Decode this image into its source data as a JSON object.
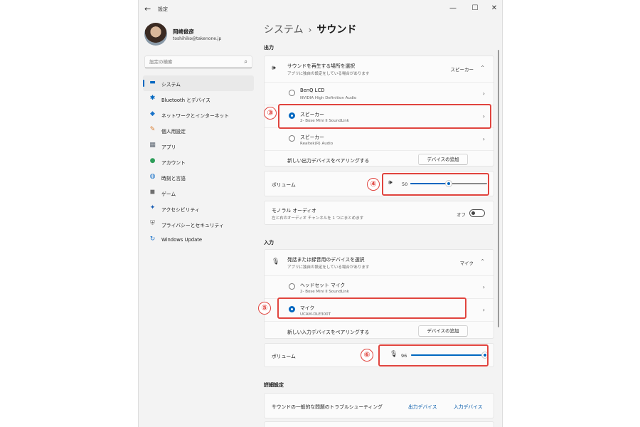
{
  "window": {
    "app_title": "設定",
    "back_icon": "←",
    "minimize_icon": "—",
    "maximize_icon": "☐",
    "close_icon": "✕"
  },
  "profile": {
    "name": "岡崎俊彦",
    "email": "toshihiko@takenone.jp"
  },
  "search": {
    "placeholder": "設定の検索",
    "icon": "⌕"
  },
  "sidebar": {
    "items": [
      {
        "label": "システム",
        "icon": "▬",
        "icon_color": "#0067c0",
        "active": true
      },
      {
        "label": "Bluetooth とデバイス",
        "icon": "✱",
        "icon_color": "#0067c0"
      },
      {
        "label": "ネットワークとインターネット",
        "icon": "◆",
        "icon_color": "#1a73c9"
      },
      {
        "label": "個人用設定",
        "icon": "✎",
        "icon_color": "#d87a2c"
      },
      {
        "label": "アプリ",
        "icon": "▦",
        "icon_color": "#5a6470"
      },
      {
        "label": "アカウント",
        "icon": "●",
        "icon_color": "#2e9e5a"
      },
      {
        "label": "時刻と言語",
        "icon": "◍",
        "icon_color": "#1a73c9"
      },
      {
        "label": "ゲーム",
        "icon": "◼",
        "icon_color": "#6f6f6f"
      },
      {
        "label": "アクセシビリティ",
        "icon": "✦",
        "icon_color": "#1a5fb4"
      },
      {
        "label": "プライバシーとセキュリティ",
        "icon": "⛨",
        "icon_color": "#6f6f6f"
      },
      {
        "label": "Windows Update",
        "icon": "↻",
        "icon_color": "#1a73c9"
      }
    ]
  },
  "breadcrumb": {
    "parent": "システム",
    "separator": "›",
    "current": "サウンド"
  },
  "output": {
    "heading": "出力",
    "select_title": "サウンドを再生する場所を選択",
    "select_sub": "アプリに独自の設定をしている場合があります",
    "selected_value": "スピーカー",
    "expand_icon": "⌃",
    "devices": [
      {
        "name": "BenQ LCD",
        "detail": "NVIDIA High Definition Audio",
        "selected": false
      },
      {
        "name": "スピーカー",
        "detail": "2- Bose Mini II SoundLink",
        "selected": true
      },
      {
        "name": "スピーカー",
        "detail": "Realtek(R) Audio",
        "selected": false
      }
    ],
    "pair_label": "新しい出力デバイスをペアリングする",
    "add_button": "デバイスの追加",
    "volume_label": "ボリューム",
    "volume_value": "50",
    "volume_level": 0.5,
    "mono_title": "モノラル オーディオ",
    "mono_sub": "左と右のオーディオ チャンネルを 1 つにまとめます",
    "mono_state": "オフ"
  },
  "input": {
    "heading": "入力",
    "select_title": "発話または録音用のデバイスを選択",
    "select_sub": "アプリに独自の設定をしている場合があります",
    "selected_value": "マイク",
    "devices": [
      {
        "name": "ヘッドセット マイク",
        "detail": "2- Bose Mini II SoundLink",
        "selected": false
      },
      {
        "name": "マイク",
        "detail": "UCAM-DLE300T",
        "selected": true
      }
    ],
    "pair_label": "新しい入力デバイスをペアリングする",
    "add_button": "デバイスの追加",
    "volume_label": "ボリューム",
    "volume_value": "96",
    "volume_level": 0.96
  },
  "advanced": {
    "heading": "詳細設定",
    "troubleshoot_label": "サウンドの一般的な問題のトラブルシューティング",
    "link_output": "出力デバイス",
    "link_input": "入力デバイス"
  },
  "callouts": [
    "③",
    "④",
    "⑤",
    "⑥"
  ],
  "colors": {
    "accent": "#0067c0",
    "callout": "#e0443e"
  }
}
